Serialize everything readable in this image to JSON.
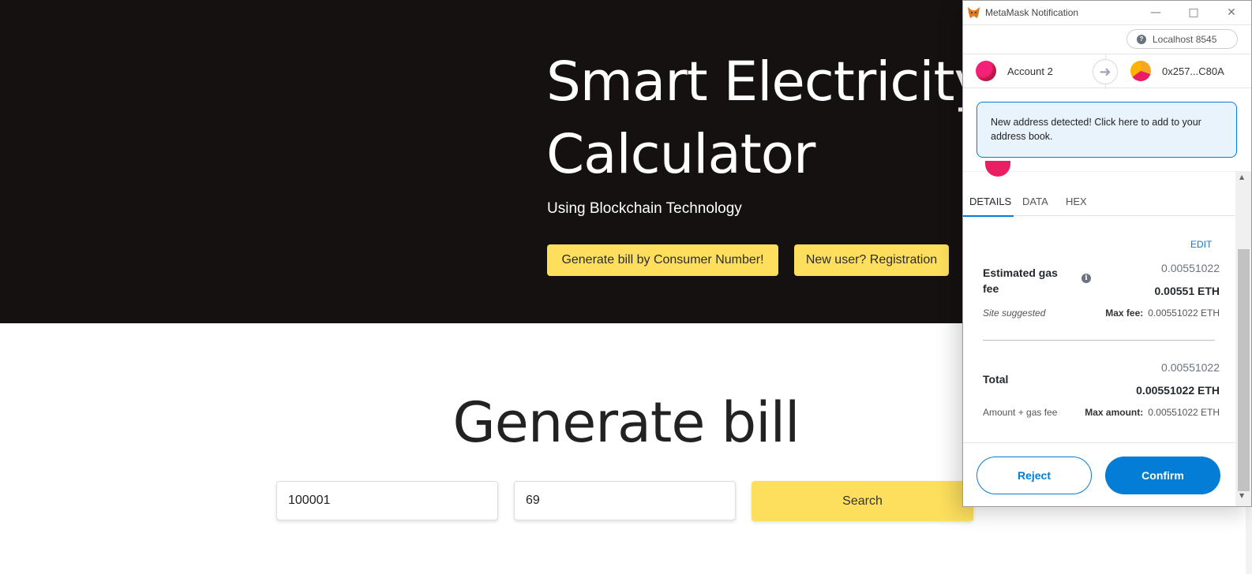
{
  "website": {
    "hero": {
      "title_line1": "Smart Electricity",
      "title_line2": "Calculator",
      "subtitle": "Using Blockchain Technology",
      "btn_generate": "Generate bill by Consumer Number!",
      "btn_register": "New user? Registration"
    },
    "section_title": "Generate bill",
    "consumer_number_value": "100001",
    "units_value": "69",
    "search_label": "Search"
  },
  "metamask": {
    "window_title": "MetaMask Notification",
    "network": "Localhost 8545",
    "from_account": "Account 2",
    "to_address": "0x257...C80A",
    "notice": "New address detected! Click here to add to your address book.",
    "tabs": [
      "DETAILS",
      "DATA",
      "HEX"
    ],
    "edit_label": "EDIT",
    "gas_label": "Estimated gas fee",
    "gas_secondary": "0.00551022",
    "gas_primary": "0.00551 ETH",
    "site_suggested": "Site suggested",
    "max_fee_label": "Max fee:",
    "max_fee_value": "0.00551022 ETH",
    "total_label": "Total",
    "total_secondary": "0.00551022",
    "total_primary": "0.00551022 ETH",
    "amount_gas_label": "Amount + gas fee",
    "max_amount_label": "Max amount:",
    "max_amount_value": "0.00551022 ETH",
    "reject_label": "Reject",
    "confirm_label": "Confirm"
  }
}
